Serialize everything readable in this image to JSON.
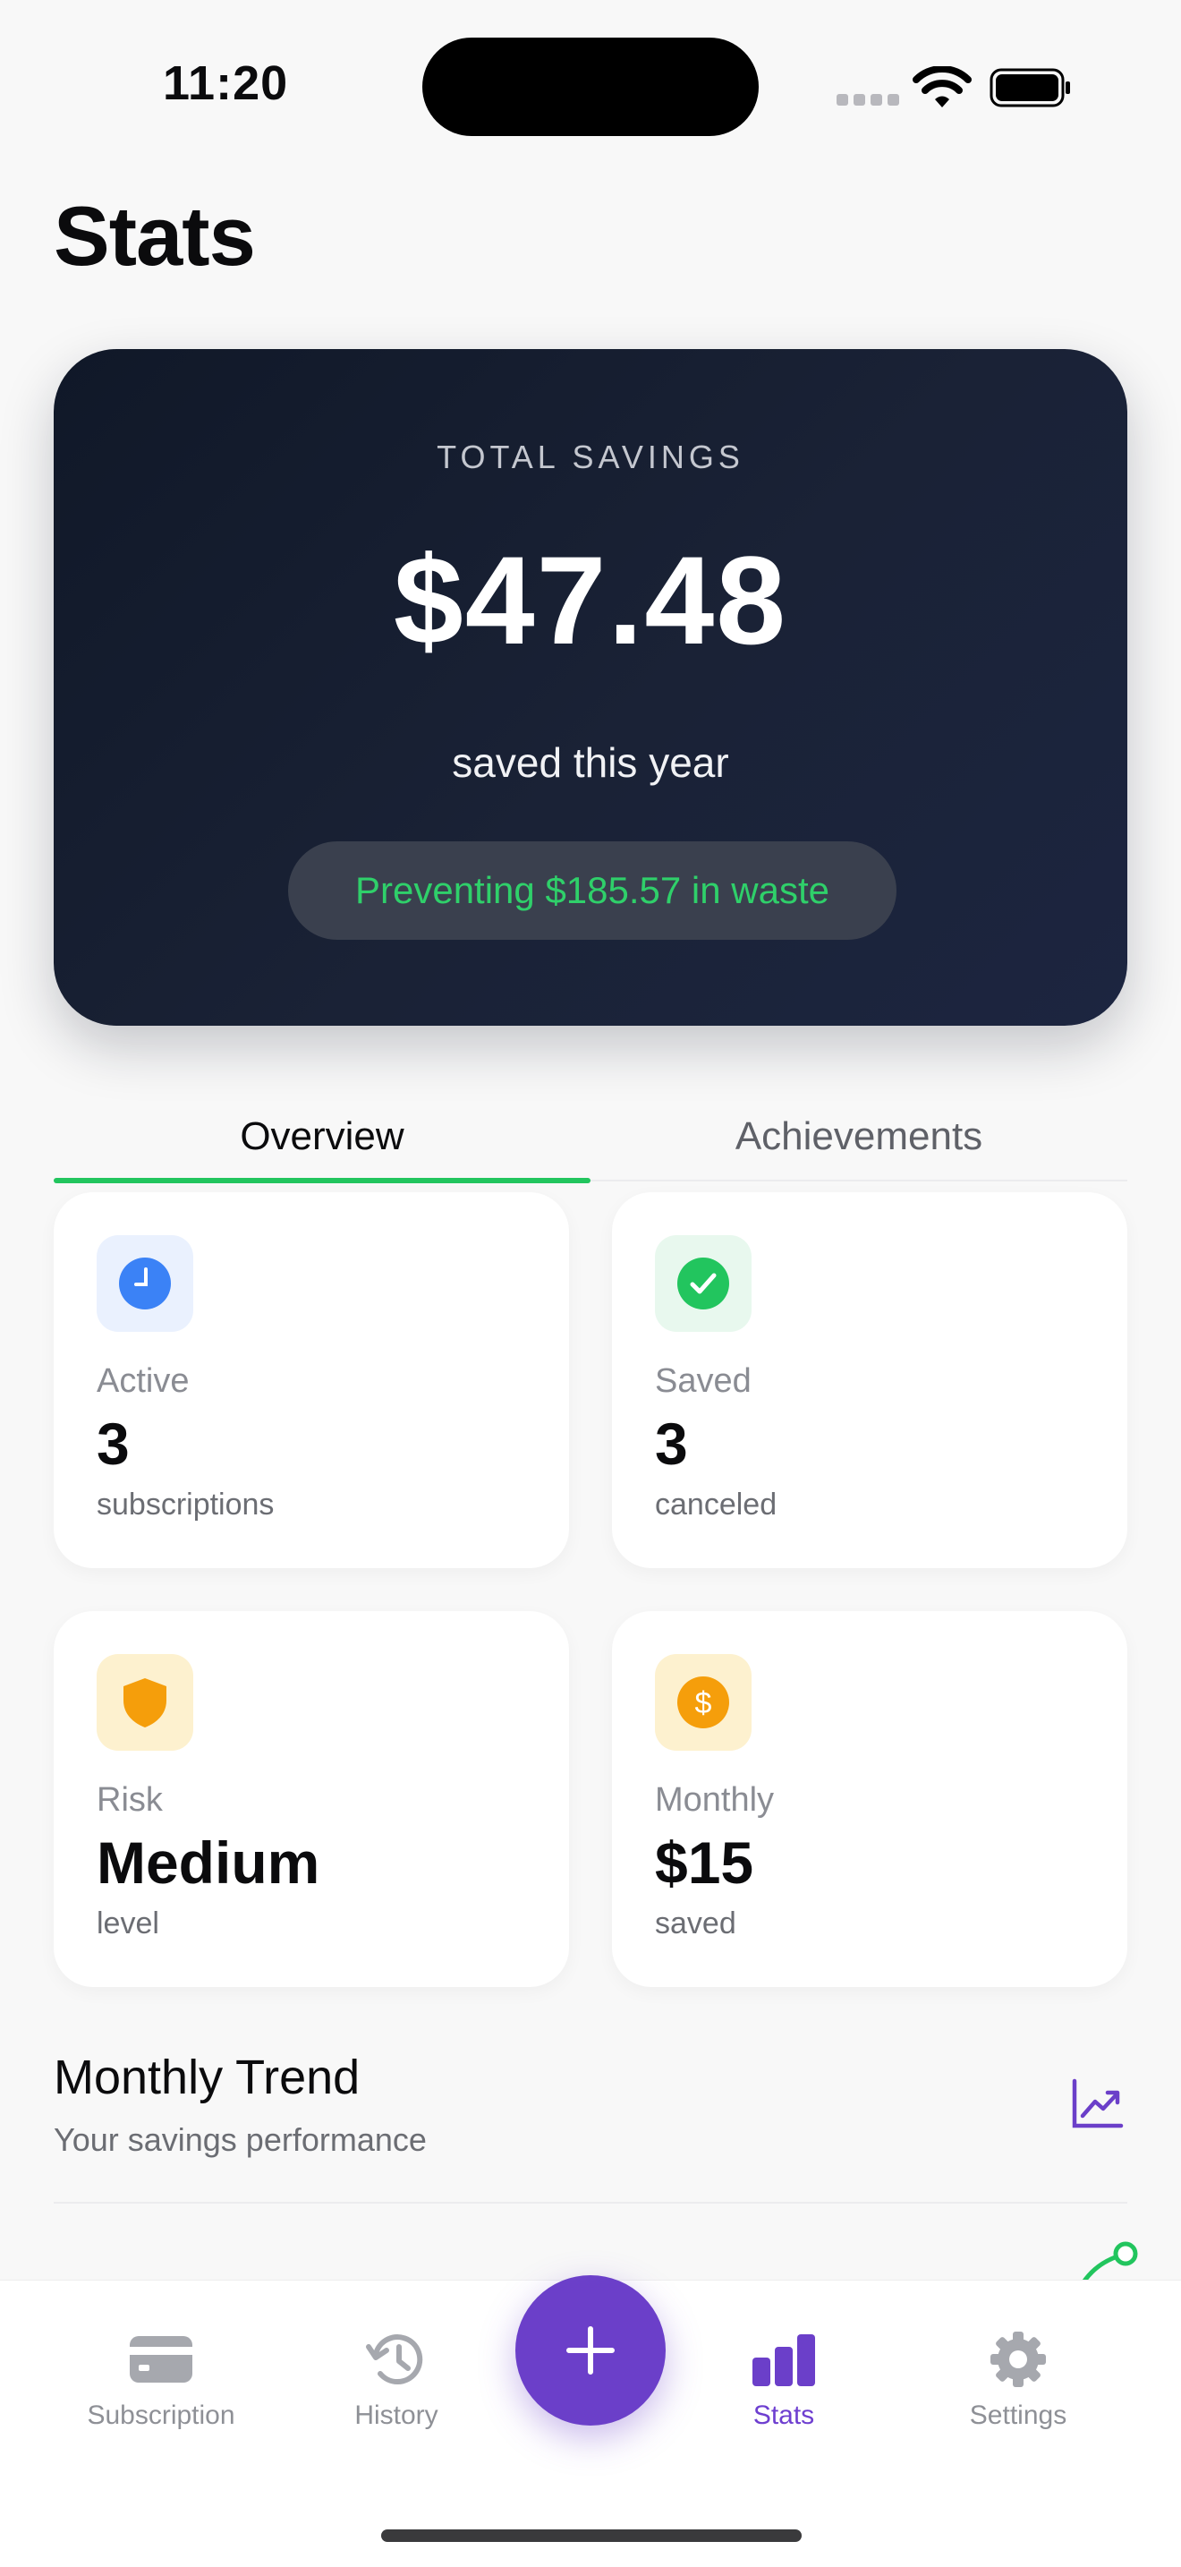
{
  "status_bar": {
    "time": "11:20"
  },
  "header": {
    "title": "Stats"
  },
  "hero": {
    "label": "TOTAL SAVINGS",
    "amount": "$47.48",
    "subtitle": "saved this year",
    "waste_text": "Preventing $185.57 in waste",
    "waste_color": "#2fd06a"
  },
  "tabs": [
    {
      "label": "Overview",
      "active": true
    },
    {
      "label": "Achievements",
      "active": false
    }
  ],
  "stats": [
    {
      "icon": "clock-icon",
      "label": "Active",
      "value": "3",
      "unit": "subscriptions",
      "accent": "#3b82f6"
    },
    {
      "icon": "check-circle-icon",
      "label": "Saved",
      "value": "3",
      "unit": "canceled",
      "accent": "#22c55e"
    },
    {
      "icon": "shield-icon",
      "label": "Risk",
      "value": "Medium",
      "unit": "level",
      "accent": "#f59e0b"
    },
    {
      "icon": "dollar-coin-icon",
      "label": "Monthly",
      "value": "$15",
      "unit": "saved",
      "accent": "#f59e0b"
    }
  ],
  "trend": {
    "title": "Monthly Trend",
    "subtitle": "Your savings performance",
    "icon": "trend-chart-icon"
  },
  "tabbar": {
    "items": [
      {
        "label": "Subscription",
        "icon": "card-icon"
      },
      {
        "label": "History",
        "icon": "history-icon"
      },
      {
        "label": "Stats",
        "icon": "bar-chart-icon",
        "active": true
      },
      {
        "label": "Settings",
        "icon": "gear-icon"
      }
    ],
    "fab_icon": "plus-icon",
    "accent": "#6b3fc9"
  }
}
